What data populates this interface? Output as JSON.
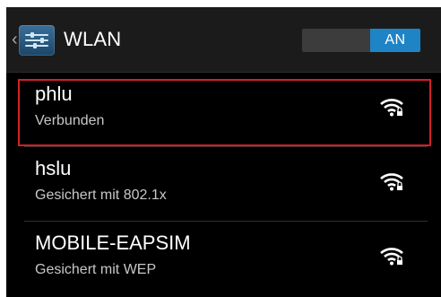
{
  "action_bar": {
    "title": "WLAN",
    "toggle_label": "AN",
    "back_icon": "chevron-left-icon",
    "settings_icon": "sliders-icon",
    "toggle_color": "#1f84c6"
  },
  "networks": [
    {
      "ssid": "phlu",
      "status": "Verbunden",
      "icon": "wifi-lock-icon",
      "highlighted": true
    },
    {
      "ssid": "hslu",
      "status": "Gesichert mit 802.1x",
      "icon": "wifi-lock-icon",
      "highlighted": false
    },
    {
      "ssid": "MOBILE-EAPSIM",
      "status": "Gesichert mit WEP",
      "icon": "wifi-lock-icon",
      "highlighted": false
    }
  ],
  "colors": {
    "highlight": "#d32027",
    "background": "#000000",
    "text_primary": "#ffffff",
    "text_secondary": "#c7c7c7"
  }
}
